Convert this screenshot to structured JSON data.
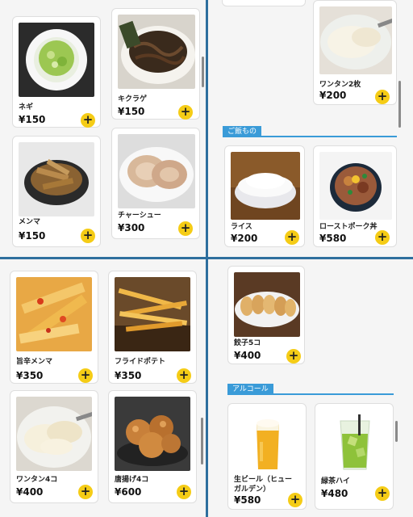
{
  "items": {
    "negi": {
      "name": "ネギ",
      "price": "¥150"
    },
    "kikurage": {
      "name": "キクラゲ",
      "price": "¥150"
    },
    "menma": {
      "name": "メンマ",
      "price": "¥150"
    },
    "chashu": {
      "name": "チャーシュー",
      "price": "¥300"
    },
    "wonton2": {
      "name": "ワンタン2枚",
      "price": "¥200"
    },
    "rice": {
      "name": "ライス",
      "price": "¥200"
    },
    "roastpork": {
      "name": "ローストポーク丼",
      "price": "¥580"
    },
    "spicy_menma": {
      "name": "旨辛メンマ",
      "price": "¥350"
    },
    "fries": {
      "name": "フライドポテト",
      "price": "¥350"
    },
    "wonton4": {
      "name": "ワンタン4コ",
      "price": "¥400"
    },
    "karaage": {
      "name": "唐揚げ4コ",
      "price": "¥600"
    },
    "gyoza": {
      "name": "餃子5コ",
      "price": "¥400"
    },
    "beer": {
      "name": "生ビール（ヒューガルデン）",
      "price": "¥580"
    },
    "greentea_high": {
      "name": "緑茶ハイ",
      "price": "¥480"
    }
  },
  "sections": {
    "rice": "ご飯もの",
    "alcohol": "アルコール"
  },
  "add_symbol": "+",
  "colors": {
    "accent_yellow": "#f5cc16",
    "section_blue": "#3a9bd8",
    "divider": "#2e6f9e"
  },
  "icons": [
    "plus-icon"
  ]
}
